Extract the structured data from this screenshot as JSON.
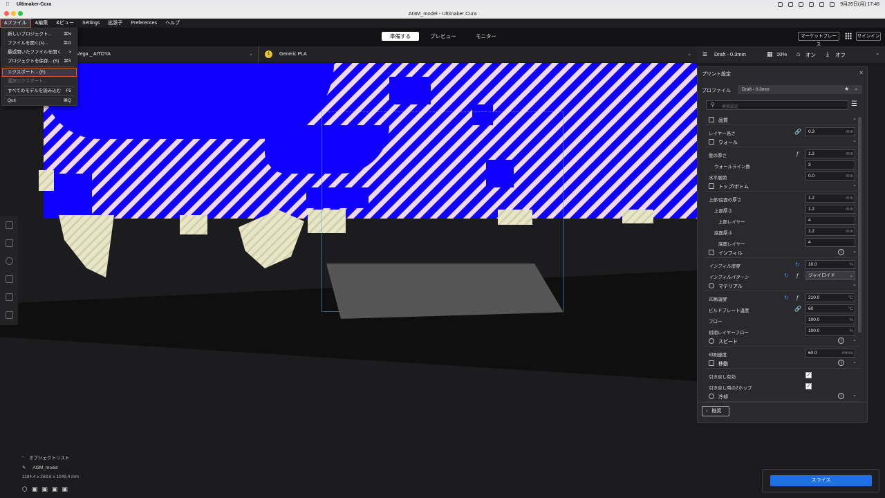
{
  "mac_menubar": {
    "app_name": "Ultimaker-Cura",
    "datetime": "9月26日(月) 17:46"
  },
  "window": {
    "title": "AI3M_model - Ultimaker Cura"
  },
  "app_menu": [
    {
      "label": "&ファイル"
    },
    {
      "label": "&編集"
    },
    {
      "label": "&ビュー"
    },
    {
      "label": "Settings"
    },
    {
      "label": "拡張子"
    },
    {
      "label": "Preferences"
    },
    {
      "label": "ヘルプ"
    }
  ],
  "stages": {
    "prepare": "準備する",
    "preview": "プレビュー",
    "monitor": "モニター"
  },
  "header_buttons": {
    "marketplace": "マーケットプレース",
    "signin": "サインイン"
  },
  "printer": {
    "name": "Mega _ AITOYA"
  },
  "material": {
    "badge": "1",
    "name": "Generic PLA"
  },
  "print_setup_summary": {
    "profile": "Draft - 0.3mm",
    "infill": "10%",
    "support": "オン",
    "adhesion": "オフ"
  },
  "file_menu": [
    {
      "label": "新しいプロジェクト...",
      "shortcut": "⌘N"
    },
    {
      "label": "ファイルを開く(s)...",
      "shortcut": "⌘O"
    },
    {
      "label": "最近開いたファイルを開く",
      "shortcut": ">"
    },
    {
      "label": "プロジェクトを保存... (S)",
      "shortcut": "⌘S"
    },
    {
      "label": "エクスポート... (E)",
      "shortcut": ""
    },
    {
      "label": "選択エクスポート...",
      "shortcut": ""
    },
    {
      "label": "すべてのモデルを読み込む",
      "shortcut": "F5"
    },
    {
      "label": "Quit",
      "shortcut": "⌘Q"
    }
  ],
  "panel": {
    "title": "プリント設定",
    "profile_label": "プロファイル",
    "profile_value": "Draft - 0.3mm",
    "search_placeholder": "検索設定",
    "recommended_button": "推奨"
  },
  "categories": {
    "quality": "品質",
    "walls": "ウォール",
    "topbottom": "トップ/ボトム",
    "infill": "インフィル",
    "material": "マテリアル",
    "speed": "スピード",
    "travel": "移動",
    "cooling": "冷却"
  },
  "settings": {
    "layer_height": {
      "label": "レイヤー高さ",
      "value": "0.3",
      "unit": "mm"
    },
    "wall_thickness": {
      "label": "壁の厚さ",
      "value": "1.2",
      "unit": "mm"
    },
    "wall_line_count": {
      "label": "ウォールライン数",
      "value": "3"
    },
    "horizontal_expansion": {
      "label": "水平展開",
      "value": "0.0",
      "unit": "mm"
    },
    "top_bottom_thickness": {
      "label": "上部/底面の厚さ",
      "value": "1.2",
      "unit": "mm"
    },
    "top_thickness": {
      "label": "上部厚さ",
      "value": "1.2",
      "unit": "mm"
    },
    "top_layers": {
      "label": "上部レイヤー",
      "value": "4"
    },
    "bottom_thickness": {
      "label": "底面厚さ",
      "value": "1.2",
      "unit": "mm"
    },
    "bottom_layers": {
      "label": "底面レイヤー",
      "value": "4"
    },
    "infill_density": {
      "label": "インフィル密度",
      "value": "10.0",
      "unit": "%"
    },
    "infill_pattern": {
      "label": "インフィルパターン",
      "value": "ジャイロイド"
    },
    "print_temperature": {
      "label": "印刷温度",
      "value": "210.0",
      "unit": "°C"
    },
    "build_plate_temperature": {
      "label": "ビルドプレート温度",
      "value": "60",
      "unit": "°C"
    },
    "flow": {
      "label": "フロー",
      "value": "100.0",
      "unit": "%"
    },
    "initial_layer_flow": {
      "label": "初期レイヤーフロー",
      "value": "100.0",
      "unit": "%"
    },
    "print_speed": {
      "label": "印刷速度",
      "value": "60.0",
      "unit": "mm/s"
    },
    "enable_retraction": {
      "label": "引き戻し有効",
      "checked": true
    },
    "z_hop": {
      "label": "引き戻し時のZホップ",
      "checked": true
    }
  },
  "object_list": {
    "toggle_label": "オブジェクトリスト",
    "model_name": "AI3M_model",
    "dimensions": "1184.4 x 268.6 x 1049.4 mm"
  },
  "slice_button": "スライス",
  "colors": {
    "accent": "#1f6fe6",
    "highlight": "#e0532c",
    "model_blue": "#1100ff"
  }
}
